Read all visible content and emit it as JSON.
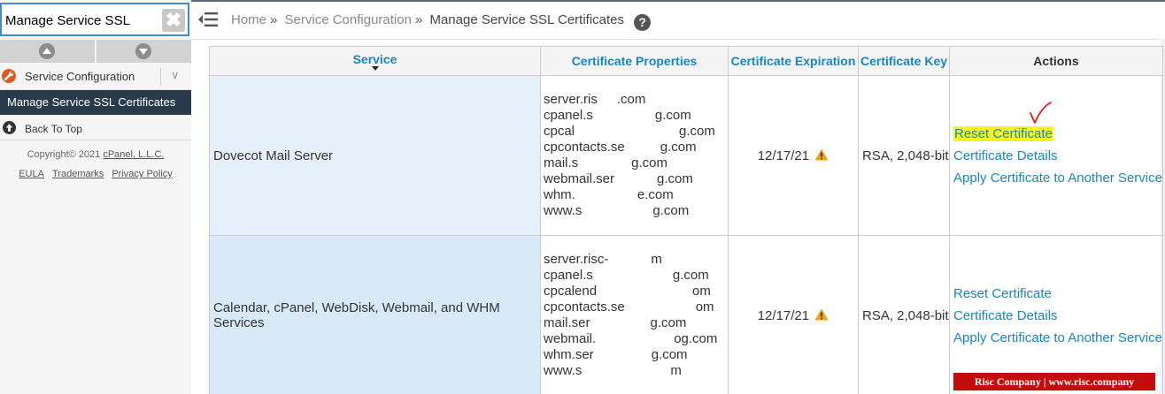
{
  "sidebar": {
    "search_value": "Manage Service SSL",
    "search_clear": "✖",
    "category_label": "Service Configuration",
    "category_chevron": "∨",
    "active_item": "Manage Service SSL Certificates",
    "back_to_top": "Back To Top",
    "copyright_prefix": "Copyright© 2021",
    "copyright_link": "cPanel, L.L.C.",
    "links": [
      "EULA",
      "Trademarks",
      "Privacy Policy"
    ]
  },
  "breadcrumb": {
    "home": "Home",
    "sep": "»",
    "section": "Service Configuration",
    "current": "Manage Service SSL Certificates",
    "help": "?"
  },
  "table": {
    "headers": {
      "service": "Service",
      "properties": "Certificate Properties",
      "expiration": "Certificate Expiration",
      "key": "Certificate Key",
      "actions": "Actions"
    },
    "rows": [
      {
        "service": "Dovecot Mail Server",
        "properties": [
          "server.ris",
          ".com",
          "cpanel.s",
          "g.com",
          "cpcal",
          "g.com",
          "cpcontacts.se",
          "g.com",
          "mail.s",
          "g.com",
          "webmail.ser",
          "g.com",
          "whm.",
          "e.com",
          "www.s",
          "g.com"
        ],
        "expiration": "12/17/21",
        "key": "RSA, 2,048-bit",
        "actions": [
          "Reset Certificate",
          "Certificate Details",
          "Apply Certificate to Another Service"
        ]
      },
      {
        "service": "Calendar, cPanel, WebDisk, Webmail, and WHM Services",
        "properties": [
          "server.risc-",
          "m",
          "cpanel.s",
          "g.com",
          "cpcalend",
          "om",
          "cpcontacts.se",
          "om",
          "mail.ser",
          "g.com",
          "webmail.",
          "og.com",
          "whm.ser",
          "g.com",
          "www.s",
          "m"
        ],
        "expiration": "12/17/21",
        "key": "RSA, 2,048-bit",
        "actions": [
          "Reset Certificate",
          "Certificate Details",
          "Apply Certificate to Another Service"
        ]
      }
    ]
  },
  "watermark": "Risc Company | www.risc.company",
  "colors": {
    "link": "#1a84c6",
    "nav_active": "#293a4a",
    "highlight": "#f6f620",
    "warning": "#f0a30a",
    "watermark_bg": "#c40c0c"
  }
}
